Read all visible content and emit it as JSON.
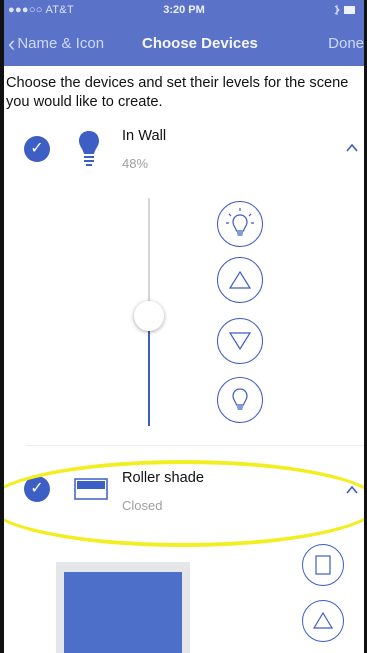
{
  "status_bar": {
    "carrier": "●●●○○ AT&T",
    "time": "3:20 PM"
  },
  "nav": {
    "back_label": "Name & Icon",
    "title": "Choose Devices",
    "done_label": "Done"
  },
  "intro_text": "Choose the devices and set their levels for the scene you would like to create.",
  "devices": [
    {
      "name": "In Wall",
      "status": "48%",
      "checked": true,
      "expanded": true,
      "icon": "lightbulb-icon",
      "level": 0.48,
      "controls": [
        "bulb-on-icon",
        "triangle-up-icon",
        "triangle-down-icon",
        "bulb-off-icon"
      ]
    },
    {
      "name": "Roller shade",
      "status": "Closed",
      "checked": true,
      "expanded": true,
      "icon": "window-shade-icon",
      "controls": [
        "square-icon",
        "triangle-up-icon"
      ]
    }
  ],
  "colors": {
    "accent": "#3d5ec4",
    "navbar": "#5a72c8",
    "highlight": "#f2ee22"
  }
}
